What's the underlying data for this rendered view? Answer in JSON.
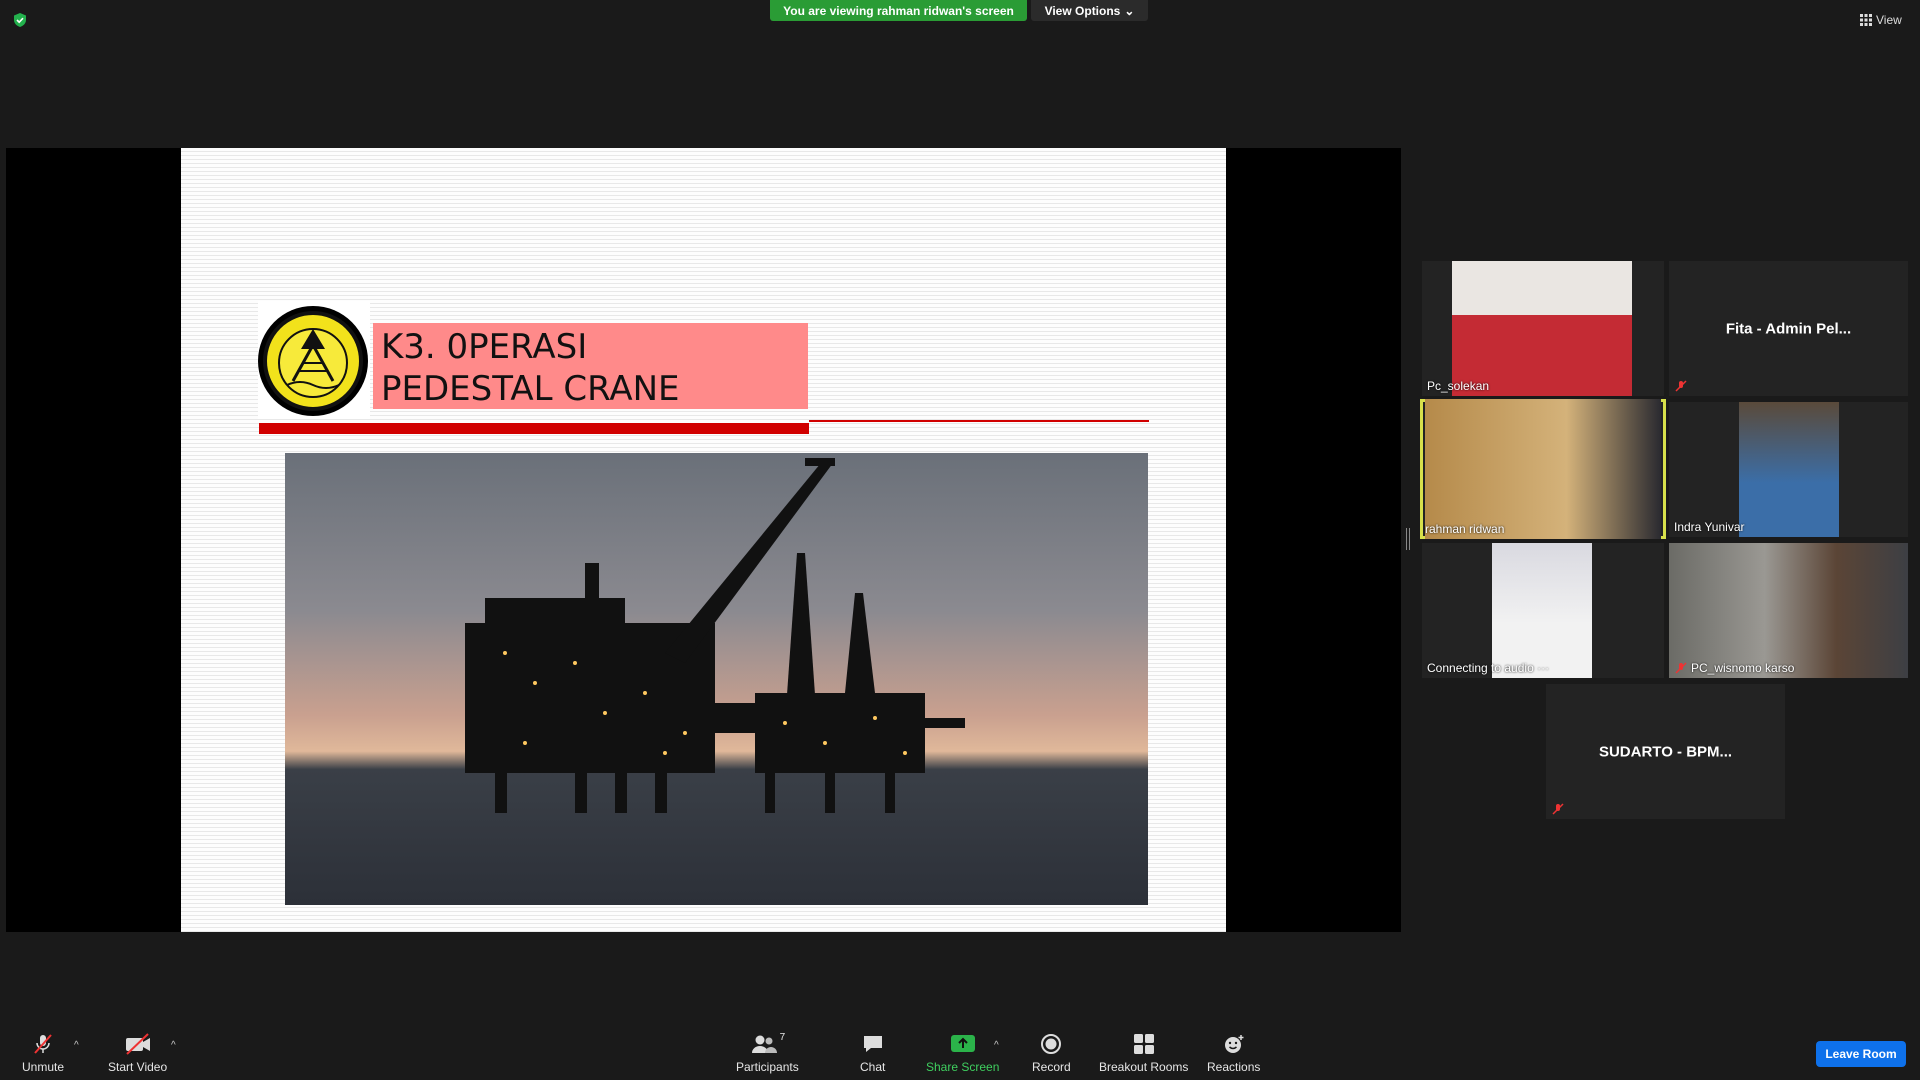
{
  "top_bar": {
    "banner_text": "You are viewing rahman ridwan's screen",
    "view_options_label": "View Options",
    "view_label": "View",
    "banner_color": "#2a9c35"
  },
  "slide": {
    "title_line1": "K3. 0PERASI",
    "title_line2": "PEDESTAL CRANE",
    "accent_color": "#d10000",
    "title_box_color": "#ff8a8a"
  },
  "participants": [
    {
      "name": "Pc_solekan",
      "video": true,
      "muted": false
    },
    {
      "name": "Fita - Admin Pel...",
      "video": false,
      "muted": true
    },
    {
      "name": "rahman ridwan",
      "video": true,
      "muted": false,
      "active_speaker": true
    },
    {
      "name": "Indra Yunivar",
      "video": true,
      "muted": false
    },
    {
      "name": "Connecting to audio ···",
      "video": true,
      "muted": false
    },
    {
      "name": "PC_wisnomo karso",
      "video": true,
      "muted": true
    },
    {
      "name": "SUDARTO - BPM...",
      "video": false,
      "muted": true
    }
  ],
  "toolbar": {
    "unmute": "Unmute",
    "start_video": "Start Video",
    "participants": "Participants",
    "participants_count": "7",
    "chat": "Chat",
    "share_screen": "Share Screen",
    "record": "Record",
    "breakout_rooms": "Breakout Rooms",
    "reactions": "Reactions",
    "leave_room": "Leave Room",
    "share_color": "#2bb34a",
    "leave_color": "#0e71eb"
  }
}
